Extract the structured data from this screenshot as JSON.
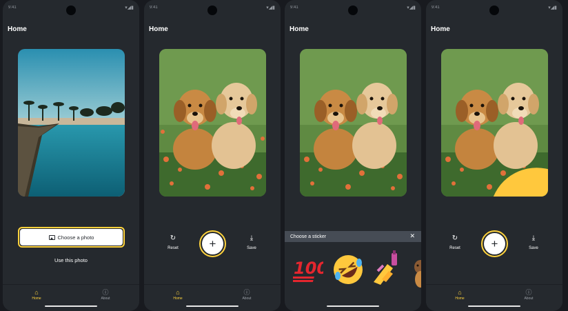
{
  "screens": [
    {
      "status_time": "9:41",
      "title": "Home",
      "choose_label": "Choose a photo",
      "use_label": "Use this photo",
      "tabs": [
        "Home",
        "About"
      ]
    },
    {
      "status_time": "9:41",
      "title": "Home",
      "reset_label": "Reset",
      "save_label": "Save",
      "add_symbol": "+",
      "tabs": [
        "Home",
        "About"
      ]
    },
    {
      "status_time": "9:41",
      "title": "Home",
      "sheet_title": "Choose a sticker",
      "close_symbol": "✕",
      "stickers": [
        "hundred-points",
        "rolling-laughing",
        "nail-polish",
        "dog"
      ]
    },
    {
      "status_time": "9:41",
      "title": "Home",
      "reset_label": "Reset",
      "save_label": "Save",
      "add_symbol": "+",
      "tabs": [
        "Home",
        "About"
      ]
    }
  ],
  "colors": {
    "background": "#25292e",
    "accent": "#ffd33d",
    "text": "#ffffff"
  },
  "icons": [
    "home-icon",
    "info-icon",
    "image-icon",
    "refresh-icon",
    "download-icon",
    "close-icon"
  ]
}
